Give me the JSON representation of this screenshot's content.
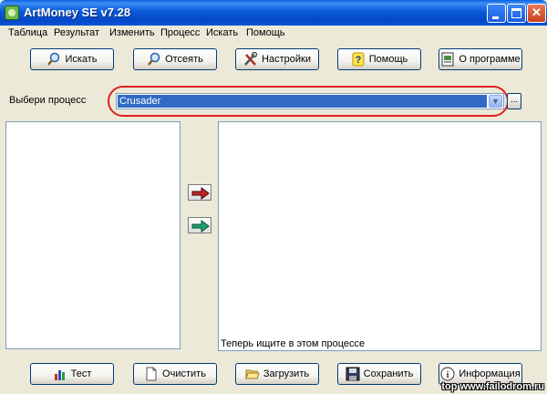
{
  "window": {
    "title": "ArtMoney SE v7.28"
  },
  "menu": [
    "Таблица",
    "Результат",
    "Изменить",
    "Процесс",
    "Искать",
    "Помощь"
  ],
  "toolbar": {
    "search": "Искать",
    "filter": "Отсеять",
    "settings": "Настройки",
    "help": "Помощь",
    "about": "О программе"
  },
  "process": {
    "label": "Выбери процесс",
    "selected": "Crusader",
    "browse": "..."
  },
  "status": {
    "text": "Теперь ищите в этом процессе"
  },
  "bottom": {
    "test": "Тест",
    "clear": "Очистить",
    "load": "Загрузить",
    "save": "Сохранить",
    "info": "Информация"
  },
  "watermark": "top www.failodrom.ru",
  "colors": {
    "title_bar": "#0a52d8",
    "selection": "#316ac5",
    "highlight_oval": "#e02020"
  }
}
